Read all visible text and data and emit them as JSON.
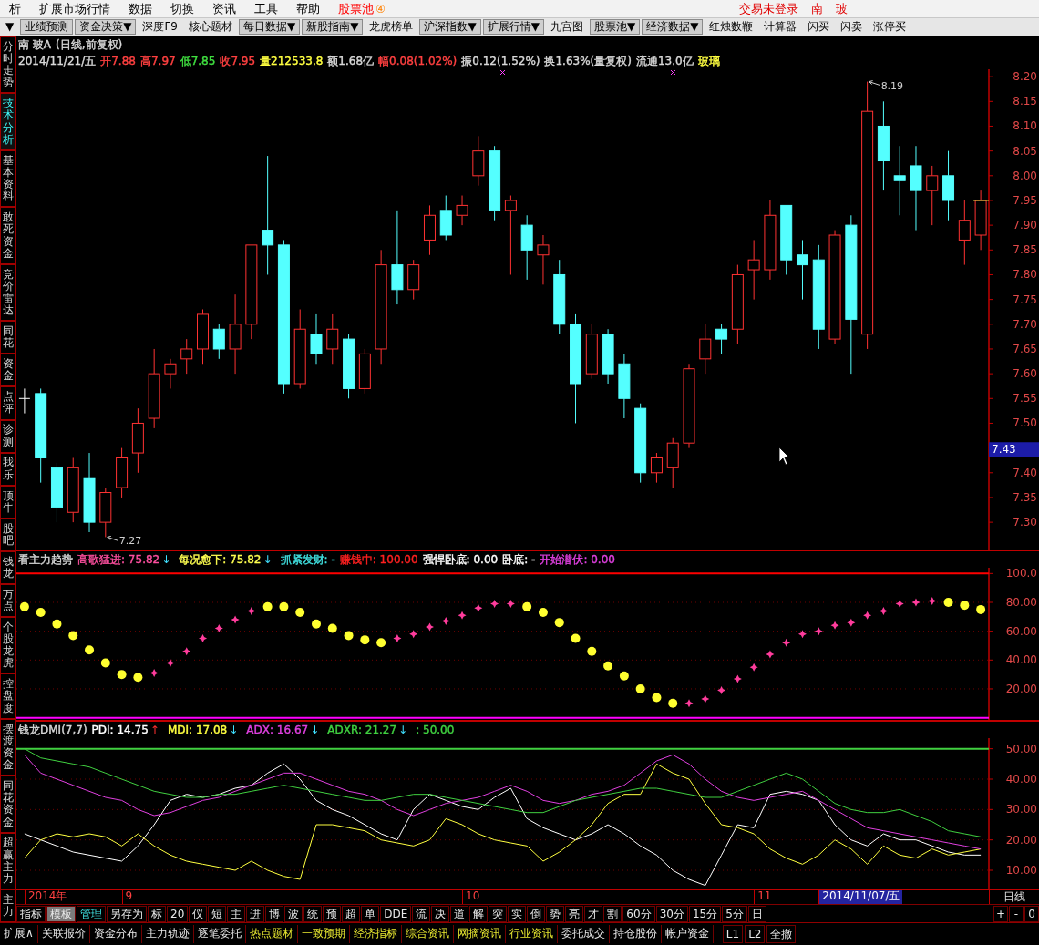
{
  "menu_bar": {
    "items": [
      {
        "label": "析",
        "highlighted": false
      },
      {
        "label": "扩展市场行情",
        "highlighted": false
      },
      {
        "label": "数据",
        "highlighted": false
      },
      {
        "label": "切换",
        "highlighted": false
      },
      {
        "label": "资讯",
        "highlighted": false
      },
      {
        "label": "工具",
        "highlighted": false
      },
      {
        "label": "帮助",
        "highlighted": false
      },
      {
        "label": "股票池",
        "badge": "④",
        "highlighted": true
      }
    ],
    "status": [
      "交易未登录",
      "南",
      "玻"
    ]
  },
  "toolbar": [
    {
      "label": "▼",
      "dropdown": false
    },
    {
      "label": "业绩预测",
      "dropdown": true
    },
    {
      "label": "资金决策▼",
      "dropdown": true
    },
    {
      "label": "深度F9",
      "dropdown": false
    },
    {
      "label": "核心题材",
      "dropdown": false
    },
    {
      "label": "每日数据▼",
      "dropdown": true
    },
    {
      "label": "新股指南▼",
      "dropdown": true
    },
    {
      "label": "龙虎榜单",
      "dropdown": false
    },
    {
      "label": "沪深指数▼",
      "dropdown": true
    },
    {
      "label": "扩展行情▼",
      "dropdown": true
    },
    {
      "label": "九宫图",
      "dropdown": false
    },
    {
      "label": "股票池▼",
      "dropdown": true
    },
    {
      "label": "经济数据▼",
      "dropdown": true
    },
    {
      "label": "红烛数鞭",
      "dropdown": false
    },
    {
      "label": "计算器",
      "dropdown": false
    },
    {
      "label": "闪买",
      "dropdown": false
    },
    {
      "label": "闪卖",
      "dropdown": false
    },
    {
      "label": "涨停买",
      "dropdown": false
    }
  ],
  "side_tabs": [
    {
      "label": "分时走势",
      "selected": false
    },
    {
      "label": "技术分析",
      "selected": true
    },
    {
      "label": "基本资料",
      "selected": false
    },
    {
      "label": "敢死资金",
      "selected": false
    },
    {
      "label": "竞价雷达",
      "selected": false
    },
    {
      "label": "同花",
      "selected": false
    },
    {
      "label": "资金",
      "selected": false
    },
    {
      "label": "点评",
      "selected": false
    },
    {
      "label": "诊测",
      "selected": false
    },
    {
      "label": "我乐",
      "selected": false
    },
    {
      "label": "顶牛",
      "selected": false
    },
    {
      "label": "股吧",
      "selected": false
    },
    {
      "label": "钱龙",
      "selected": false
    },
    {
      "label": "万点",
      "selected": false
    },
    {
      "label": "个股龙虎",
      "selected": false
    },
    {
      "label": "控盘度",
      "selected": false
    },
    {
      "label": "摆渡资金",
      "selected": false
    },
    {
      "label": "同花资金",
      "selected": false
    },
    {
      "label": "超赢主力",
      "selected": false
    },
    {
      "label": "主力",
      "selected": false
    }
  ],
  "stock_chart": {
    "title": "南 玻A",
    "period": "(日线,前复权)",
    "date": "2014/11/21/五",
    "quote": [
      {
        "text": "开7.88",
        "color": "#ff4040"
      },
      {
        "text": "高7.97",
        "color": "#ff4040"
      },
      {
        "text": "低7.85",
        "color": "#40e040"
      },
      {
        "text": "收7.95",
        "color": "#ff4040"
      },
      {
        "text": "量212533.8",
        "color": "#ffff40"
      },
      {
        "text": "额1.68亿",
        "color": "#d8d8d8"
      },
      {
        "text": "幅0.08(1.02%)",
        "color": "#ff4040"
      },
      {
        "text": "振0.12(1.52%)",
        "color": "#d8d8d8"
      },
      {
        "text": "换1.63%(量复权)",
        "color": "#d8d8d8"
      },
      {
        "text": "流通13.0亿",
        "color": "#d8d8d8"
      },
      {
        "text": "玻璃",
        "color": "#ffff40"
      }
    ],
    "cursor_price": "7.43",
    "chart_data": {
      "type": "candlestick",
      "ylim": [
        7.245,
        8.215
      ],
      "yticks": [
        {
          "value": 7.3,
          "label": "7.30"
        },
        {
          "value": 7.35,
          "label": "7.35"
        },
        {
          "value": 7.4,
          "label": "7.40"
        },
        {
          "value": 7.5,
          "label": "7.50"
        },
        {
          "value": 7.55,
          "label": "7.55"
        },
        {
          "value": 7.6,
          "label": "7.60"
        },
        {
          "value": 7.65,
          "label": "7.65"
        },
        {
          "value": 7.7,
          "label": "7.70"
        },
        {
          "value": 7.75,
          "label": "7.75"
        },
        {
          "value": 7.8,
          "label": "7.80"
        },
        {
          "value": 7.85,
          "label": "7.85"
        },
        {
          "value": 7.9,
          "label": "7.90"
        },
        {
          "value": 7.95,
          "label": "7.95"
        },
        {
          "value": 8.0,
          "label": "8.00"
        },
        {
          "value": 8.05,
          "label": "8.05"
        },
        {
          "value": 8.1,
          "label": "8.10"
        },
        {
          "value": 8.15,
          "label": "8.15"
        },
        {
          "value": 8.2,
          "label": "8.20"
        }
      ],
      "categories": [
        null,
        null,
        null,
        null,
        null,
        null,
        null,
        null,
        null,
        null,
        null,
        null,
        null,
        null,
        null,
        null,
        null,
        null,
        null,
        null,
        null,
        null,
        null,
        null,
        null,
        null,
        null,
        null,
        null,
        null,
        null,
        null,
        null,
        null,
        null,
        null,
        null,
        null,
        null,
        null,
        null,
        null,
        null,
        null,
        null,
        null,
        null,
        null,
        null,
        null,
        null,
        null,
        null,
        null,
        null,
        null,
        null,
        null,
        null,
        null
      ],
      "ohlc": [
        [
          7.55,
          7.57,
          7.52,
          7.55
        ],
        [
          7.56,
          7.57,
          7.38,
          7.43
        ],
        [
          7.41,
          7.42,
          7.3,
          7.33
        ],
        [
          7.32,
          7.43,
          7.3,
          7.41
        ],
        [
          7.39,
          7.44,
          7.28,
          7.3
        ],
        [
          7.3,
          7.37,
          7.27,
          7.36
        ],
        [
          7.37,
          7.45,
          7.35,
          7.43
        ],
        [
          7.44,
          7.53,
          7.4,
          7.5
        ],
        [
          7.51,
          7.65,
          7.49,
          7.6
        ],
        [
          7.6,
          7.63,
          7.57,
          7.62
        ],
        [
          7.63,
          7.67,
          7.6,
          7.65
        ],
        [
          7.65,
          7.73,
          7.62,
          7.72
        ],
        [
          7.69,
          7.7,
          7.63,
          7.65
        ],
        [
          7.65,
          7.76,
          7.6,
          7.7
        ],
        [
          7.7,
          7.86,
          7.67,
          7.86
        ],
        [
          7.89,
          8.04,
          7.8,
          7.86
        ],
        [
          7.86,
          7.87,
          7.56,
          7.58
        ],
        [
          7.58,
          7.73,
          7.57,
          7.69
        ],
        [
          7.68,
          7.72,
          7.62,
          7.64
        ],
        [
          7.65,
          7.72,
          7.62,
          7.69
        ],
        [
          7.67,
          7.68,
          7.55,
          7.57
        ],
        [
          7.57,
          7.65,
          7.56,
          7.64
        ],
        [
          7.65,
          7.85,
          7.62,
          7.82
        ],
        [
          7.82,
          7.93,
          7.74,
          7.77
        ],
        [
          7.77,
          7.83,
          7.75,
          7.82
        ],
        [
          7.87,
          7.94,
          7.84,
          7.92
        ],
        [
          7.93,
          7.96,
          7.87,
          7.88
        ],
        [
          7.92,
          7.96,
          7.9,
          7.94
        ],
        [
          8.0,
          8.08,
          7.98,
          8.05
        ],
        [
          8.05,
          8.06,
          7.91,
          7.93
        ],
        [
          7.93,
          7.96,
          7.8,
          7.95
        ],
        [
          7.9,
          7.92,
          7.79,
          7.85
        ],
        [
          7.84,
          7.88,
          7.78,
          7.86
        ],
        [
          7.8,
          7.83,
          7.68,
          7.7
        ],
        [
          7.7,
          7.72,
          7.5,
          7.58
        ],
        [
          7.6,
          7.7,
          7.59,
          7.68
        ],
        [
          7.68,
          7.69,
          7.58,
          7.6
        ],
        [
          7.62,
          7.64,
          7.51,
          7.55
        ],
        [
          7.53,
          7.54,
          7.38,
          7.4
        ],
        [
          7.4,
          7.44,
          7.38,
          7.43
        ],
        [
          7.41,
          7.47,
          7.37,
          7.46
        ],
        [
          7.46,
          7.62,
          7.45,
          7.61
        ],
        [
          7.63,
          7.7,
          7.6,
          7.67
        ],
        [
          7.69,
          7.7,
          7.64,
          7.67
        ],
        [
          7.69,
          7.82,
          7.66,
          7.8
        ],
        [
          7.81,
          7.87,
          7.75,
          7.83
        ],
        [
          7.81,
          7.95,
          7.79,
          7.92
        ],
        [
          7.94,
          7.94,
          7.8,
          7.83
        ],
        [
          7.84,
          7.87,
          7.75,
          7.82
        ],
        [
          7.83,
          7.86,
          7.65,
          7.69
        ],
        [
          7.67,
          7.89,
          7.66,
          7.88
        ],
        [
          7.9,
          7.92,
          7.6,
          7.71
        ],
        [
          7.68,
          8.19,
          7.65,
          8.13
        ],
        [
          8.1,
          8.15,
          7.97,
          8.03
        ],
        [
          8.0,
          8.06,
          7.92,
          7.99
        ],
        [
          8.02,
          8.06,
          7.89,
          7.97
        ],
        [
          7.97,
          8.02,
          7.9,
          8.0
        ],
        [
          8.0,
          8.05,
          7.91,
          7.95
        ],
        [
          7.87,
          7.95,
          7.82,
          7.91
        ],
        [
          7.88,
          7.97,
          7.85,
          7.95
        ]
      ],
      "annotations": [
        "8.19",
        "7.27"
      ]
    }
  },
  "trend_indicator": {
    "title": "看主力趋势",
    "items": [
      {
        "label": "高歌猛进:",
        "value": "75.82",
        "arrow": "↓",
        "rising": false,
        "color": "#ff50a0"
      },
      {
        "label": "每况愈下:",
        "value": "75.82",
        "arrow": "↓",
        "rising": false,
        "color": "#ffff50"
      },
      {
        "label": "抓紧发财:",
        "value": "-",
        "color": "#40e0e0"
      },
      {
        "label": "赚钱中:",
        "value": "100.00",
        "color": "#ff2020"
      },
      {
        "label": "强悍卧底:",
        "value": "0.00",
        "color": "#ffffff"
      },
      {
        "label": "卧底:",
        "value": "-",
        "color": "#ffffff"
      },
      {
        "label": "开始潜伏:",
        "value": "0.00",
        "color": "#e040e0"
      }
    ],
    "chart_data": {
      "type": "scatter",
      "ylim": [
        -1.5,
        104
      ],
      "grid": true,
      "categories": [
        null,
        null,
        null,
        null,
        null,
        null,
        null,
        null,
        null,
        null,
        null,
        null,
        null,
        null,
        null,
        null,
        null,
        null,
        null,
        null,
        null,
        null,
        null,
        null,
        null,
        null,
        null,
        null,
        null,
        null,
        null,
        null,
        null,
        null,
        null,
        null,
        null,
        null,
        null,
        null,
        null,
        null,
        null,
        null,
        null,
        null,
        null,
        null,
        null,
        null,
        null,
        null,
        null,
        null,
        null,
        null,
        null,
        null,
        null,
        null
      ],
      "yticks": [
        {
          "value": 20,
          "label": "20.00"
        },
        {
          "value": 40,
          "label": "40.00"
        },
        {
          "value": 60,
          "label": "60.00"
        },
        {
          "value": 80,
          "label": "80.00"
        },
        {
          "value": 100,
          "label": "100.0"
        }
      ],
      "series": [
        {
          "color": "#ff3c9c",
          "values": [
            null,
            null,
            null,
            null,
            null,
            null,
            null,
            null,
            31,
            38,
            46,
            55,
            62,
            68,
            74,
            null,
            null,
            null,
            null,
            null,
            null,
            null,
            null,
            55,
            58,
            63,
            67,
            71,
            76,
            79,
            79,
            null,
            null,
            null,
            null,
            null,
            null,
            null,
            null,
            null,
            null,
            10,
            13,
            19,
            27,
            35,
            44,
            52,
            58,
            60,
            64,
            66,
            71,
            74,
            79,
            80,
            81,
            null,
            null,
            null
          ]
        },
        {
          "color": "#ffff30",
          "values": [
            77,
            73,
            65,
            57,
            47,
            38,
            30,
            28,
            null,
            null,
            null,
            null,
            null,
            null,
            null,
            77,
            77,
            73,
            65,
            62,
            57,
            54,
            52,
            null,
            null,
            null,
            null,
            null,
            null,
            null,
            null,
            77,
            73,
            66,
            55,
            46,
            36,
            29,
            20,
            14,
            10,
            null,
            null,
            null,
            null,
            null,
            null,
            null,
            null,
            null,
            null,
            null,
            null,
            null,
            null,
            null,
            null,
            80,
            78,
            75
          ]
        }
      ],
      "ref_lines": [
        {
          "axis": "y",
          "value": 100,
          "color": "#ff0000"
        },
        {
          "axis": "y",
          "value": 0,
          "color": "#ff00ff"
        }
      ]
    }
  },
  "dmi_indicator": {
    "title": "钱龙DMI(7,7)",
    "items": [
      {
        "label": "PDI:",
        "value": "14.75",
        "arrow": "↑",
        "rising": true,
        "color": "#ffffff"
      },
      {
        "label": "MDI:",
        "value": "17.08",
        "arrow": "↓",
        "rising": false,
        "color": "#ffff40"
      },
      {
        "label": "ADX:",
        "value": "16.67",
        "arrow": "↓",
        "rising": false,
        "color": "#e040e0"
      },
      {
        "label": "ADXR:",
        "value": "21.27",
        "arrow": "↓",
        "rising": false,
        "color": "#40d040"
      },
      {
        "label": ":",
        "value": "50.00",
        "color": "#40d040"
      }
    ],
    "chart_data": {
      "type": "line",
      "ylim": [
        4,
        53.5
      ],
      "grid": true,
      "categories": [
        null,
        null,
        null,
        null,
        null,
        null,
        null,
        null,
        null,
        null,
        null,
        null,
        null,
        null,
        null,
        null,
        null,
        null,
        null,
        null,
        null,
        null,
        null,
        null,
        null,
        null,
        null,
        null,
        null,
        null,
        null,
        null,
        null,
        null,
        null,
        null,
        null,
        null,
        null,
        null,
        null,
        null,
        null,
        null,
        null,
        null,
        null,
        null,
        null,
        null,
        null,
        null,
        null,
        null,
        null,
        null,
        null,
        null,
        null,
        null
      ],
      "yticks": [
        {
          "value": 10,
          "label": "10.00"
        },
        {
          "value": 20,
          "label": "20.00"
        },
        {
          "value": 30,
          "label": "30.00"
        },
        {
          "value": 40,
          "label": "40.00"
        },
        {
          "value": 50,
          "label": "50.00"
        }
      ],
      "series": [
        {
          "color": "#ffffff",
          "values": [
            22,
            20,
            18,
            16,
            15,
            14,
            13,
            18,
            25,
            33,
            35,
            34,
            35,
            37,
            38,
            42,
            45,
            40,
            33,
            30,
            28,
            25,
            22,
            20,
            30,
            35,
            33,
            31,
            30,
            34,
            37,
            27,
            24,
            22,
            20,
            22,
            25,
            22,
            18,
            15,
            10,
            7,
            5,
            15,
            25,
            24,
            35,
            36,
            35,
            33,
            25,
            20,
            18,
            22,
            20,
            20,
            18,
            16,
            15,
            15
          ]
        },
        {
          "color": "#ffff40",
          "values": [
            14,
            20,
            22,
            21,
            22,
            21,
            18,
            22,
            18,
            15,
            13,
            12,
            11,
            10,
            13,
            10,
            8,
            7,
            25,
            25,
            24,
            23,
            20,
            19,
            18,
            20,
            27,
            25,
            22,
            20,
            19,
            18,
            13,
            16,
            20,
            25,
            32,
            35,
            35,
            45,
            42,
            40,
            32,
            25,
            24,
            22,
            17,
            14,
            12,
            15,
            20,
            17,
            12,
            18,
            15,
            14,
            17,
            15,
            16,
            17
          ]
        },
        {
          "color": "#e040e0",
          "values": [
            48,
            42,
            40,
            38,
            36,
            34,
            33,
            30,
            28,
            29,
            31,
            33,
            34,
            36,
            38,
            40,
            42,
            42,
            40,
            38,
            36,
            35,
            33,
            30,
            28,
            30,
            32,
            33,
            34,
            36,
            38,
            36,
            33,
            32,
            33,
            35,
            36,
            38,
            42,
            46,
            48,
            45,
            40,
            36,
            34,
            33,
            34,
            35,
            36,
            33,
            30,
            27,
            24,
            23,
            22,
            21,
            20,
            19,
            18,
            17
          ]
        },
        {
          "color": "#40d040",
          "values": [
            50,
            47,
            46,
            45,
            44,
            42,
            40,
            38,
            36,
            35,
            34,
            34,
            35,
            35,
            36,
            37,
            38,
            37,
            36,
            35,
            34,
            33,
            33,
            34,
            35,
            35,
            34,
            33,
            32,
            31,
            30,
            29,
            29,
            31,
            33,
            34,
            35,
            36,
            37,
            37,
            36,
            35,
            34,
            34,
            36,
            38,
            40,
            42,
            40,
            36,
            32,
            30,
            29,
            29,
            30,
            28,
            26,
            23,
            22,
            21
          ]
        }
      ],
      "ref_lines": [
        {
          "axis": "y",
          "value": 50,
          "color": "#40d040"
        }
      ]
    }
  },
  "date_axis": {
    "labels": [
      {
        "text": "2014年",
        "cursor": false
      },
      {
        "text": "9",
        "cursor": false
      },
      {
        "text": "10",
        "cursor": false
      },
      {
        "text": "11",
        "cursor": false
      },
      {
        "text": "2014/11/07/五",
        "cursor": true
      }
    ],
    "period": "日线"
  },
  "period_toolbar": {
    "items": [
      {
        "label": "指标",
        "selected": false,
        "highlighted": false
      },
      {
        "label": "模板",
        "selected": true,
        "highlighted": false
      },
      {
        "label": "管理",
        "selected": false,
        "highlighted": true
      },
      {
        "label": "另存为",
        "selected": false,
        "highlighted": false
      },
      {
        "label": "标",
        "selected": false,
        "highlighted": false
      },
      {
        "label": "20",
        "selected": false,
        "highlighted": false
      },
      {
        "label": "仪",
        "selected": false,
        "highlighted": false
      },
      {
        "label": "短",
        "selected": false,
        "highlighted": false
      },
      {
        "label": "主",
        "selected": false,
        "highlighted": false
      },
      {
        "label": "进",
        "selected": false,
        "highlighted": false
      },
      {
        "label": "博",
        "selected": false,
        "highlighted": false
      },
      {
        "label": "波",
        "selected": false,
        "highlighted": false
      },
      {
        "label": "统",
        "selected": false,
        "highlighted": false
      },
      {
        "label": "预",
        "selected": false,
        "highlighted": false
      },
      {
        "label": "超",
        "selected": false,
        "highlighted": false
      },
      {
        "label": "单",
        "selected": false,
        "highlighted": false
      },
      {
        "label": "DDE",
        "selected": false,
        "highlighted": false
      },
      {
        "label": "流",
        "selected": false,
        "highlighted": false
      },
      {
        "label": "决",
        "selected": false,
        "highlighted": false
      },
      {
        "label": "道",
        "selected": false,
        "highlighted": false
      },
      {
        "label": "解",
        "selected": false,
        "highlighted": false
      },
      {
        "label": "突",
        "selected": false,
        "highlighted": false
      },
      {
        "label": "实",
        "selected": false,
        "highlighted": false
      },
      {
        "label": "倒",
        "selected": false,
        "highlighted": false
      },
      {
        "label": "势",
        "selected": false,
        "highlighted": false
      },
      {
        "label": "亮",
        "selected": false,
        "highlighted": false
      },
      {
        "label": "才",
        "selected": false,
        "highlighted": false
      },
      {
        "label": "割",
        "selected": false,
        "highlighted": false
      },
      {
        "label": "60分",
        "selected": false,
        "highlighted": false
      },
      {
        "label": "30分",
        "selected": false,
        "highlighted": false
      },
      {
        "label": "15分",
        "selected": false,
        "highlighted": false
      },
      {
        "label": "5分",
        "selected": false,
        "highlighted": false
      },
      {
        "label": "日",
        "selected": false,
        "highlighted": false
      }
    ],
    "zoom": [
      "+",
      "-",
      "0"
    ]
  },
  "function_bar": {
    "items": [
      {
        "label": "扩展∧",
        "highlighted": false
      },
      {
        "label": "关联报价",
        "highlighted": false
      },
      {
        "label": "资金分布",
        "highlighted": false
      },
      {
        "label": "主力轨迹",
        "highlighted": false
      },
      {
        "label": "逐笔委托",
        "highlighted": false
      },
      {
        "label": "热点题材",
        "highlighted": true
      },
      {
        "label": "一致预期",
        "highlighted": true
      },
      {
        "label": "经济指标",
        "highlighted": true
      },
      {
        "label": "综合资讯",
        "highlighted": true
      },
      {
        "label": "网摘资讯",
        "highlighted": true
      },
      {
        "label": "行业资讯",
        "highlighted": true
      },
      {
        "label": "委托成交",
        "highlighted": false
      },
      {
        "label": "持仓股份",
        "highlighted": false
      },
      {
        "label": "帐户资金",
        "highlighted": false
      }
    ],
    "trade_buttons": [
      "L1",
      "L2",
      "全撤"
    ]
  }
}
